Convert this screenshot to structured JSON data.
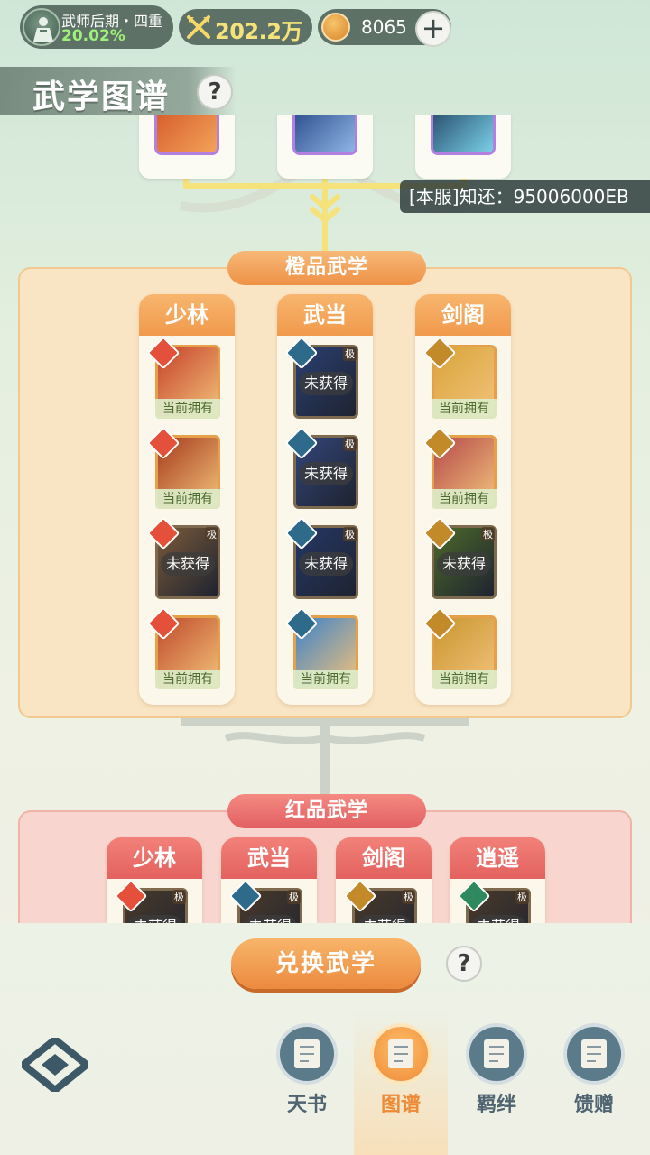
{
  "topbar": {
    "rank_title": "武师后期・四重",
    "rank_percent": "20.02%",
    "power": "202.2万",
    "coins": "8065",
    "plus": "+"
  },
  "header": {
    "title": "武学图谱",
    "help": "?"
  },
  "ticker": "[本服]知还：95006000EB",
  "sections": [
    {
      "title": "橙品武学",
      "columns": [
        {
          "name": "少林",
          "skills": [
            {
              "status": "当前拥有",
              "art": "#c6412a"
            },
            {
              "status": "当前拥有",
              "art": "#a63a1c"
            },
            {
              "status": "未获得",
              "art": "#7b5a3a",
              "grade": "极"
            },
            {
              "status": "当前拥有",
              "art": "#c04a2a"
            }
          ]
        },
        {
          "name": "武当",
          "skills": [
            {
              "status": "未获得",
              "art": "#2a3f72",
              "grade": "极"
            },
            {
              "status": "未获得",
              "art": "#33467a",
              "grade": "极"
            },
            {
              "status": "未获得",
              "art": "#253766",
              "grade": "极"
            },
            {
              "status": "当前拥有",
              "art": "#3d82c9"
            }
          ]
        },
        {
          "name": "剑阁",
          "skills": [
            {
              "status": "当前拥有",
              "art": "#d9a43a"
            },
            {
              "status": "当前拥有",
              "art": "#b54a4a"
            },
            {
              "status": "未获得",
              "art": "#4d6a2a",
              "grade": "极"
            },
            {
              "status": "当前拥有",
              "art": "#c9952f"
            }
          ]
        }
      ]
    },
    {
      "title": "红品武学",
      "columns": [
        {
          "name": "少林",
          "status": "未获得"
        },
        {
          "name": "武当",
          "status": "未获得"
        },
        {
          "name": "剑阁",
          "status": "未获得"
        },
        {
          "name": "逍遥",
          "status": "未获得"
        }
      ]
    }
  ],
  "grade_label": "极",
  "actions": {
    "exchange": "兑换武学",
    "help": "?"
  },
  "nav": [
    {
      "label": "天书",
      "icon": "book-icon"
    },
    {
      "label": "图谱",
      "icon": "map-scroll-icon",
      "active": true
    },
    {
      "label": "羁绊",
      "icon": "handshake-icon"
    },
    {
      "label": "馈赠",
      "icon": "gift-bag-icon"
    }
  ]
}
